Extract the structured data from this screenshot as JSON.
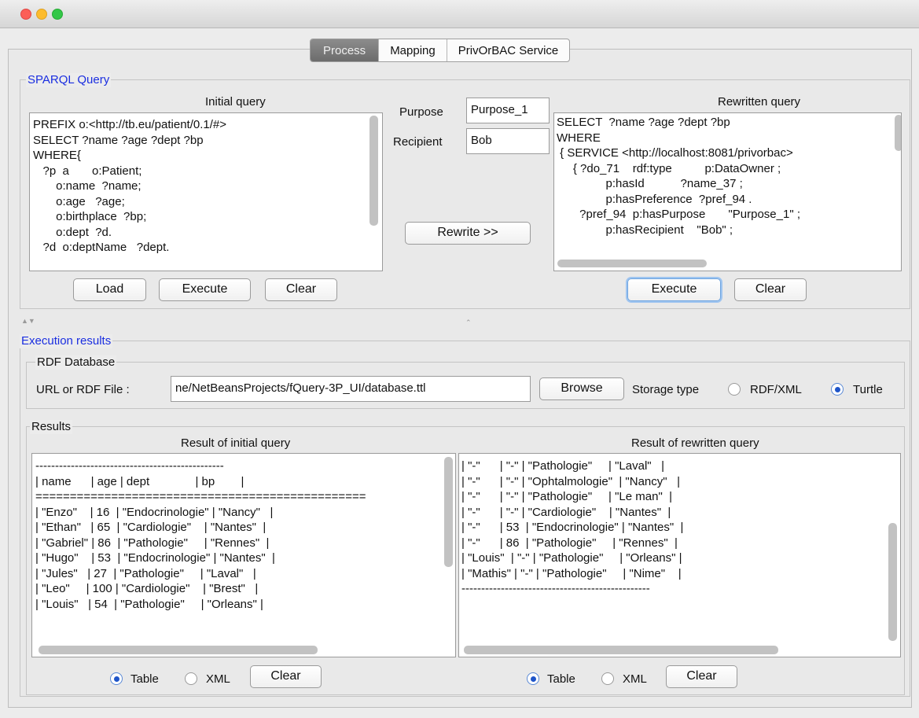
{
  "tabs": [
    "Process",
    "Mapping",
    "PrivOrBAC Service"
  ],
  "sparql": {
    "legend": "SPARQL Query",
    "initial_label": "Initial query",
    "rewritten_label": "Rewritten query",
    "initial_lines": [
      "PREFIX o:<http://tb.eu/patient/0.1/#>",
      "SELECT ?name ?age ?dept ?bp",
      "WHERE{",
      "   ?p  a       o:Patient;",
      "       o:name  ?name;",
      "       o:age   ?age;",
      "       o:birthplace  ?bp;",
      "       o:dept  ?d.",
      "   ?d  o:deptName   ?dept."
    ],
    "rewritten_lines": [
      "SELECT  ?name ?age ?dept ?bp",
      "WHERE",
      " { SERVICE <http://localhost:8081/privorbac>",
      "     { ?do_71    rdf:type          p:DataOwner ;",
      "               p:hasId           ?name_37 ;",
      "               p:hasPreference  ?pref_94 .",
      "       ?pref_94  p:hasPurpose       \"Purpose_1\" ;",
      "               p:hasRecipient    \"Bob\" ;"
    ],
    "purpose_label": "Purpose",
    "purpose_value": "Purpose_1",
    "recipient_label": "Recipient",
    "recipient_value": "Bob",
    "rewrite_button": "Rewrite  >>",
    "load_button": "Load",
    "execute_button": "Execute",
    "clear_button": "Clear",
    "execute2_button": "Execute",
    "clear2_button": "Clear"
  },
  "execution": {
    "legend": "Execution results",
    "rdf_legend": "RDF Database",
    "url_label": "URL or RDF File :",
    "url_value": "ne/NetBeansProjects/fQuery-3P_UI/database.ttl",
    "browse_button": "Browse",
    "storage_label": "Storage type",
    "storage_rdfxml": "RDF/XML",
    "storage_turtle": "Turtle",
    "storage_selected": "Turtle"
  },
  "results": {
    "legend": "Results",
    "initial_label": "Result of initial query",
    "rewritten_label": "Result of rewritten query",
    "initial_lines": [
      "------------------------------------------------",
      "| name      | age | dept              | bp        |",
      "================================================",
      "| \"Enzo\"    | 16  | \"Endocrinologie\" | \"Nancy\"   |",
      "| \"Ethan\"   | 65  | \"Cardiologie\"    | \"Nantes\"  |",
      "| \"Gabriel\" | 86  | \"Pathologie\"     | \"Rennes\"  |",
      "| \"Hugo\"    | 53  | \"Endocrinologie\" | \"Nantes\"  |",
      "| \"Jules\"   | 27  | \"Pathologie\"     | \"Laval\"   |",
      "| \"Leo\"     | 100 | \"Cardiologie\"    | \"Brest\"   |",
      "| \"Louis\"   | 54  | \"Pathologie\"     | \"Orleans\" |"
    ],
    "rewritten_lines": [
      "| \"-\"      | \"-\" | \"Pathologie\"     | \"Laval\"   |",
      "| \"-\"      | \"-\" | \"Ophtalmologie\"  | \"Nancy\"   |",
      "| \"-\"      | \"-\" | \"Pathologie\"     | \"Le man\"  |",
      "| \"-\"      | \"-\" | \"Cardiologie\"    | \"Nantes\"  |",
      "| \"-\"      | 53  | \"Endocrinologie\" | \"Nantes\"  |",
      "| \"-\"      | 86  | \"Pathologie\"     | \"Rennes\"  |",
      "| \"Louis\"  | \"-\" | \"Pathologie\"     | \"Orleans\" |",
      "| \"Mathis\" | \"-\" | \"Pathologie\"     | \"Nime\"    |",
      "------------------------------------------------"
    ],
    "table_option": "Table",
    "xml_option": "XML",
    "clear_button": "Clear",
    "selected_format": "Table"
  }
}
